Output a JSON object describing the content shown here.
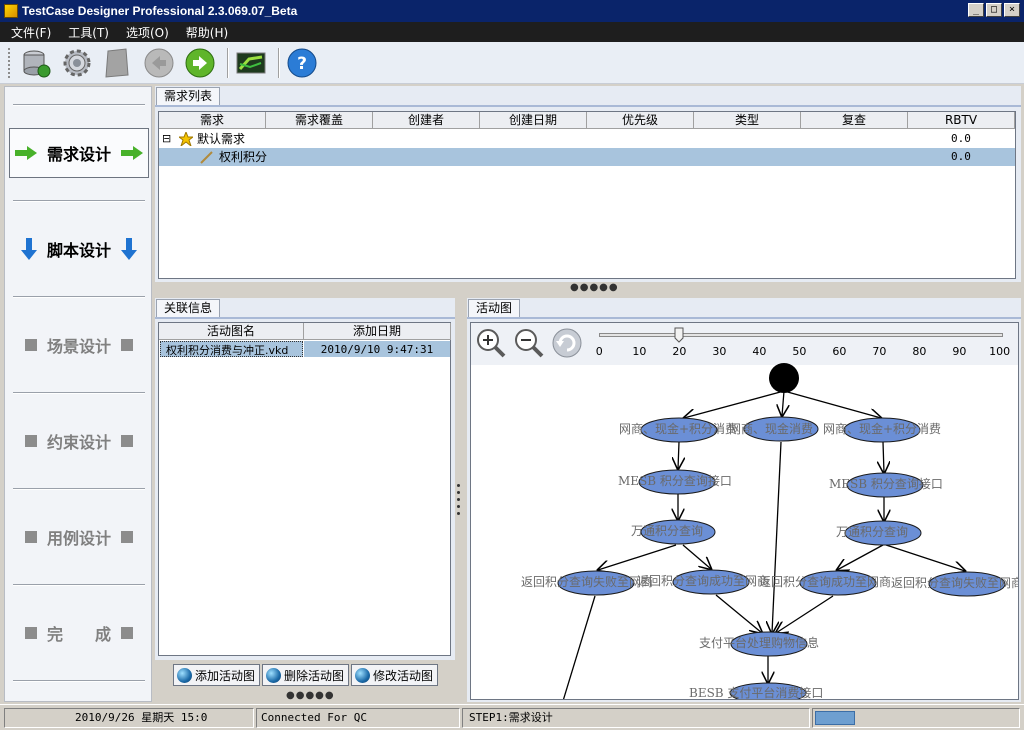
{
  "window": {
    "title": "TestCase Designer Professional  2.3.069.07_Beta",
    "minimize": "_",
    "maximize": "□",
    "close": "×"
  },
  "menu": [
    {
      "label": "文件(F)"
    },
    {
      "label": "工具(T)"
    },
    {
      "label": "选项(O)"
    },
    {
      "label": "帮助(H)"
    }
  ],
  "toolbar": {
    "icons": [
      "database-icon",
      "gear-icon",
      "page-icon",
      "back-icon",
      "forward-icon",
      "image-icon",
      "help-icon"
    ],
    "help_glyph": "?"
  },
  "leftnav": {
    "items": [
      {
        "label": "需求设计",
        "state": "active",
        "icon": "green-arrow"
      },
      {
        "label": "脚本设计",
        "state": "normal",
        "icon": "blue-down-arrow"
      },
      {
        "label": "场景设计",
        "state": "disabled"
      },
      {
        "label": "约束设计",
        "state": "disabled"
      },
      {
        "label": "用例设计",
        "state": "disabled"
      },
      {
        "label": "完　　成",
        "state": "disabled"
      }
    ]
  },
  "requirements": {
    "tab": "需求列表",
    "columns": [
      "需求",
      "需求覆盖",
      "创建者",
      "创建日期",
      "优先级",
      "类型",
      "复查",
      "RBTV"
    ],
    "rows": [
      {
        "name": "默认需求",
        "rbtv": "0.0",
        "expander": "⊟"
      },
      {
        "name": "权利积分",
        "rbtv": "0.0",
        "selected": true
      }
    ]
  },
  "related": {
    "tab": "关联信息",
    "columns": [
      "活动图名",
      "添加日期"
    ],
    "rows": [
      {
        "name": "权利积分消费与冲正.vkd",
        "date": "2010/9/10 9:47:31"
      }
    ],
    "buttons": {
      "add": "添加活动图",
      "delete": "删除活动图",
      "modify": "修改活动图"
    }
  },
  "activity": {
    "tab": "活动图",
    "zoom_ticks": [
      "0",
      "10",
      "20",
      "30",
      "40",
      "50",
      "60",
      "70",
      "80",
      "90",
      "100"
    ],
    "zoom_value": 20,
    "labels": {
      "n1": "网商、现金+积分消费",
      "n2": "网商、现金消费",
      "n3": "网商、现金+积分消费",
      "n4": "MESB 积分查询接口",
      "n5": "MESB 积分查询接口",
      "n6": "万通积分查询",
      "n7": "万通积分查询",
      "n8": "返回积分查询失败至网商",
      "n9": "返回积分查询成功至网商",
      "n10": "返回积分查询成功至网商",
      "n11": "返回积分查询失败至网商",
      "n12": "支付平台处理购物信息",
      "n13": "BESB 支付平台消费接口"
    }
  },
  "status": {
    "datetime": "2010/9/26 星期天  15:0",
    "connection": "Connected For QC",
    "step": "STEP1:需求设计"
  }
}
